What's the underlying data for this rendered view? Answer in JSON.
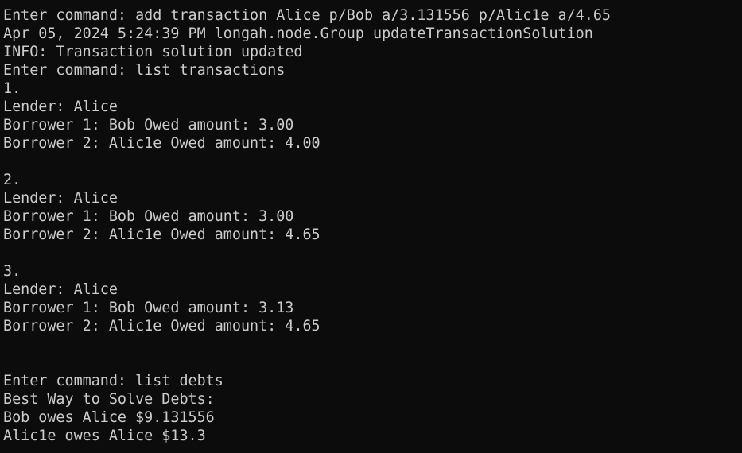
{
  "terminal": {
    "lines": [
      "Enter command: add transaction Alice p/Bob a/3.131556 p/Alic1e a/4.65",
      "Apr 05, 2024 5:24:39 PM longah.node.Group updateTransactionSolution",
      "INFO: Transaction solution updated",
      "Enter command: list transactions",
      "1.",
      "Lender: Alice",
      "Borrower 1: Bob Owed amount: 3.00",
      "Borrower 2: Alic1e Owed amount: 4.00",
      "",
      "2.",
      "Lender: Alice",
      "Borrower 1: Bob Owed amount: 3.00",
      "Borrower 2: Alic1e Owed amount: 4.65",
      "",
      "3.",
      "Lender: Alice",
      "Borrower 1: Bob Owed amount: 3.13",
      "Borrower 2: Alic1e Owed amount: 4.65",
      "",
      "",
      "Enter command: list debts",
      "Best Way to Solve Debts:",
      "Bob owes Alice $9.131556",
      "Alic1e owes Alice $13.3"
    ]
  }
}
